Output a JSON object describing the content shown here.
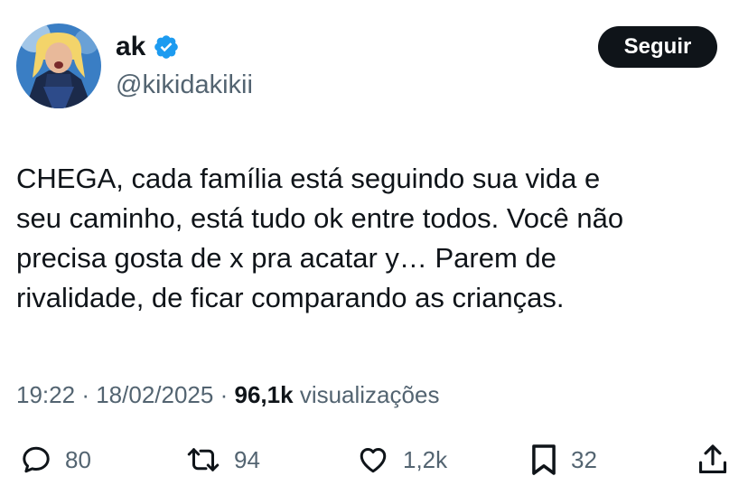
{
  "author": {
    "display_name": "ak",
    "handle": "@kikidakikii",
    "verified": true,
    "verified_color": "#1d9bf0"
  },
  "follow_label": "Seguir",
  "tweet": {
    "text": "CHEGA, cada família está seguindo sua vida e\nseu caminho, está tudo ok entre todos. Você não\nprecisa gosta de x pra acatar y… Parem de\nrivalidade, de ficar comparando as crianças."
  },
  "meta": {
    "time": "19:22",
    "date": "18/02/2025",
    "separator": "·",
    "views_count": "96,1k",
    "views_label": "visualizações"
  },
  "actions": {
    "reply_icon": "speech-bubble",
    "reply_count": "80",
    "retweet_icon": "repost-arrows",
    "retweet_count": "94",
    "like_icon": "heart",
    "like_count": "1,2k",
    "bookmark_icon": "bookmark",
    "bookmark_count": "32",
    "share_icon": "share-upload"
  },
  "colors": {
    "text_primary": "#0f1419",
    "text_secondary": "#536471",
    "button_bg": "#0f1419"
  }
}
